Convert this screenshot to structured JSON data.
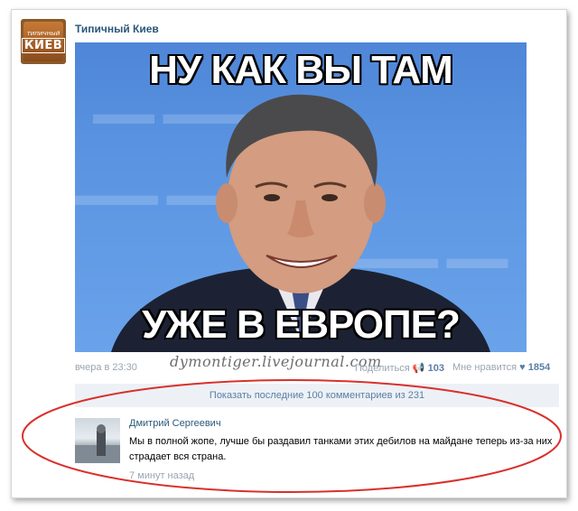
{
  "post": {
    "author": "Типичный Киев",
    "avatar_text_small": "типичный",
    "avatar_text_big": "КИЕВ",
    "meme_top": "НУ КАК ВЫ ТАМ",
    "meme_bottom": "УЖЕ В ЕВРОПЕ?",
    "timestamp": "вчера в 23:30",
    "watermark": "dymontiger.livejournal.com",
    "share_label": "Поделиться",
    "share_count": "103",
    "like_label": "Мне нравится",
    "like_count": "1854"
  },
  "comments": {
    "show_more": "Показать последние 100 комментариев из 231",
    "items": [
      {
        "author": "Дмитрий Сергеевич",
        "text": "Мы в полной жопе, лучше бы раздавил танками этих дебилов на майдане теперь из-за них страдает вся страна.",
        "time": "7 минут назад"
      }
    ]
  },
  "colors": {
    "link": "#2b587a",
    "muted": "#9aa5b1",
    "annotation": "#d9302c"
  },
  "icons": [
    "megaphone-icon",
    "heart-icon"
  ]
}
